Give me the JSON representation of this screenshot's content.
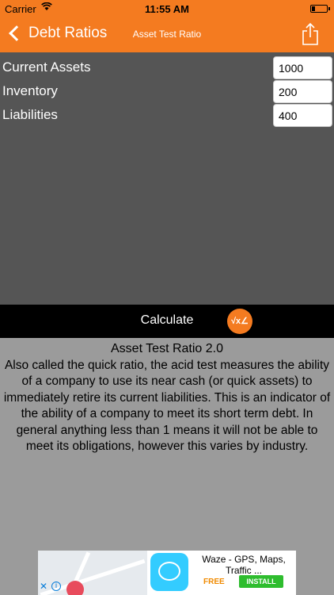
{
  "status_bar": {
    "carrier": "Carrier",
    "time": "11:55 AM"
  },
  "nav": {
    "back_label": "Debt Ratios",
    "title": "Asset Test Ratio"
  },
  "fields": [
    {
      "label": "Current Assets",
      "value": "1000"
    },
    {
      "label": "Inventory",
      "value": "200"
    },
    {
      "label": "Liabilities",
      "value": "400"
    }
  ],
  "calculate": {
    "label": "Calculate",
    "icon_text": "√x∠"
  },
  "description": {
    "title": "Asset Test Ratio 2.0",
    "body": "Also called the quick ratio, the acid test measures the ability of a company to use its near cash (or quick assets) to immediately retire its current liabilities. This is an indicator of the ability of a company to meet its short term debt. In general anything less than 1 means it will not be able to meet its obligations, however this varies by industry."
  },
  "ad": {
    "title": "Waze - GPS, Maps, Traffic ...",
    "price": "FREE",
    "install_label": "INSTALL"
  },
  "colors": {
    "accent": "#f47b20",
    "form_bg": "#555555",
    "desc_bg": "#9b9b9b"
  }
}
